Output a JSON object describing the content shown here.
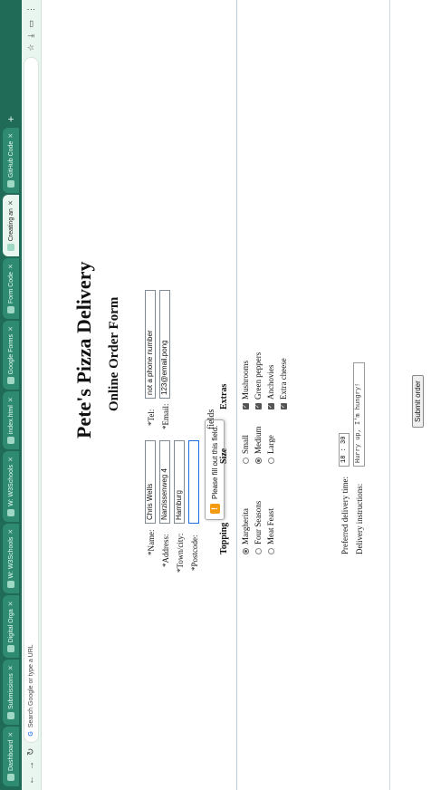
{
  "browser": {
    "tabs": [
      {
        "label": "Dashboard",
        "active": false
      },
      {
        "label": "Submissions",
        "active": false
      },
      {
        "label": "Digital Orga",
        "active": false
      },
      {
        "label": "W: W3Schools",
        "active": false
      },
      {
        "label": "W: W3Schools",
        "active": false
      },
      {
        "label": "index.html",
        "active": false
      },
      {
        "label": "Google Forms",
        "active": false
      },
      {
        "label": "Form Code",
        "active": false
      },
      {
        "label": "Creating an",
        "active": true
      },
      {
        "label": "GitHub Code",
        "active": false
      }
    ],
    "address_placeholder": "Search Google or type a URL"
  },
  "page": {
    "title": "Pete's Pizza Delivery",
    "subtitle": "Online Order Form",
    "fields": {
      "name_label": "*Name:",
      "name_value": "Chris Wells",
      "address_label": "*Address:",
      "address_value": "Narzissenweg 4",
      "town_label": "*Town/city:",
      "town_value": "Hamburg",
      "postcode_label": "*Postcode:",
      "postcode_value": "",
      "tel_label": "*Tel:",
      "tel_value": "not a phone number",
      "email_label": "*Email:",
      "email_value": "123@email.pong"
    },
    "validation_message": "Please fill out this field.",
    "fields_fragment": "fields",
    "topping": {
      "header": "Topping",
      "options": [
        {
          "label": "Margherita",
          "selected": true
        },
        {
          "label": "Four Seasons",
          "selected": false
        },
        {
          "label": "Meat Feast",
          "selected": false
        }
      ]
    },
    "size": {
      "header": "Size",
      "options": [
        {
          "label": "Small",
          "selected": false
        },
        {
          "label": "Medium",
          "selected": true
        },
        {
          "label": "Large",
          "selected": false
        }
      ]
    },
    "extras": {
      "header": "Extras",
      "options": [
        {
          "label": "Mushrooms",
          "checked": true
        },
        {
          "label": "Green peppers",
          "checked": true
        },
        {
          "label": "Anchovies",
          "checked": true
        },
        {
          "label": "Extra cheese",
          "checked": true
        }
      ]
    },
    "delivery_time_label": "Preferred delivery time:",
    "delivery_time_value": "18 : 30",
    "instructions_label": "Delivery instructions:",
    "instructions_value": "Hurry up, I'm hungry!",
    "submit_label": "Submit order"
  }
}
